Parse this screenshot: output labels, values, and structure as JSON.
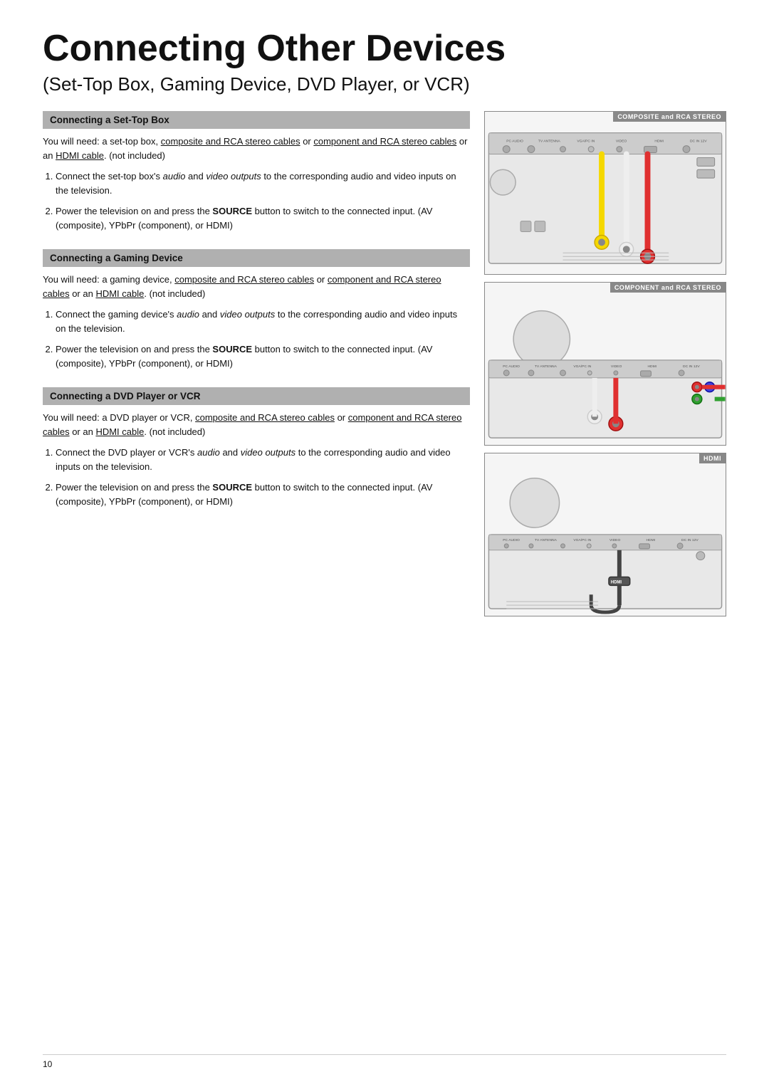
{
  "page": {
    "title": "Connecting Other Devices",
    "subtitle": "(Set-Top Box, Gaming Device, DVD Player, or VCR)",
    "page_number": "10"
  },
  "sections": [
    {
      "id": "set-top-box",
      "header": "Connecting a Set-Top Box",
      "intro": "You will need: a set-top box, composite and RCA stereo cables or component and RCA stereo cables or an HDMI cable. (not included)",
      "steps": [
        "Connect the set-top box's audio and video outputs to the corresponding audio and video inputs on the television.",
        "Power the television on and press the SOURCE button to switch to the connected input. (AV (composite), YPbPr (component), or HDMI)"
      ],
      "diagram_label": "COMPOSITE and RCA STEREO"
    },
    {
      "id": "gaming-device",
      "header": "Connecting a Gaming Device",
      "intro": "You will need: a gaming device, composite and RCA stereo cables or component and RCA stereo cables or an HDMI cable. (not included)",
      "steps": [
        "Connect the gaming device's audio and video outputs to the corresponding audio and video inputs on the television.",
        "Power the television on and press the SOURCE button to switch to the connected input. (AV (composite), YPbPr (component), or HDMI)"
      ],
      "diagram_label": "COMPONENT and RCA STEREO"
    },
    {
      "id": "dvd-vcr",
      "header": "Connecting a DVD Player or VCR",
      "intro": "You will need: a DVD player or VCR, composite and RCA stereo cables or component and RCA stereo cables or an HDMI cable. (not included)",
      "steps": [
        "Connect the DVD player or VCR's audio and video outputs to the corresponding audio and video inputs on the television.",
        "Power the television on and press the SOURCE button to switch to the connected input. (AV (composite), YPbPr (component), or HDMI)"
      ],
      "diagram_label": "HDMI"
    }
  ]
}
